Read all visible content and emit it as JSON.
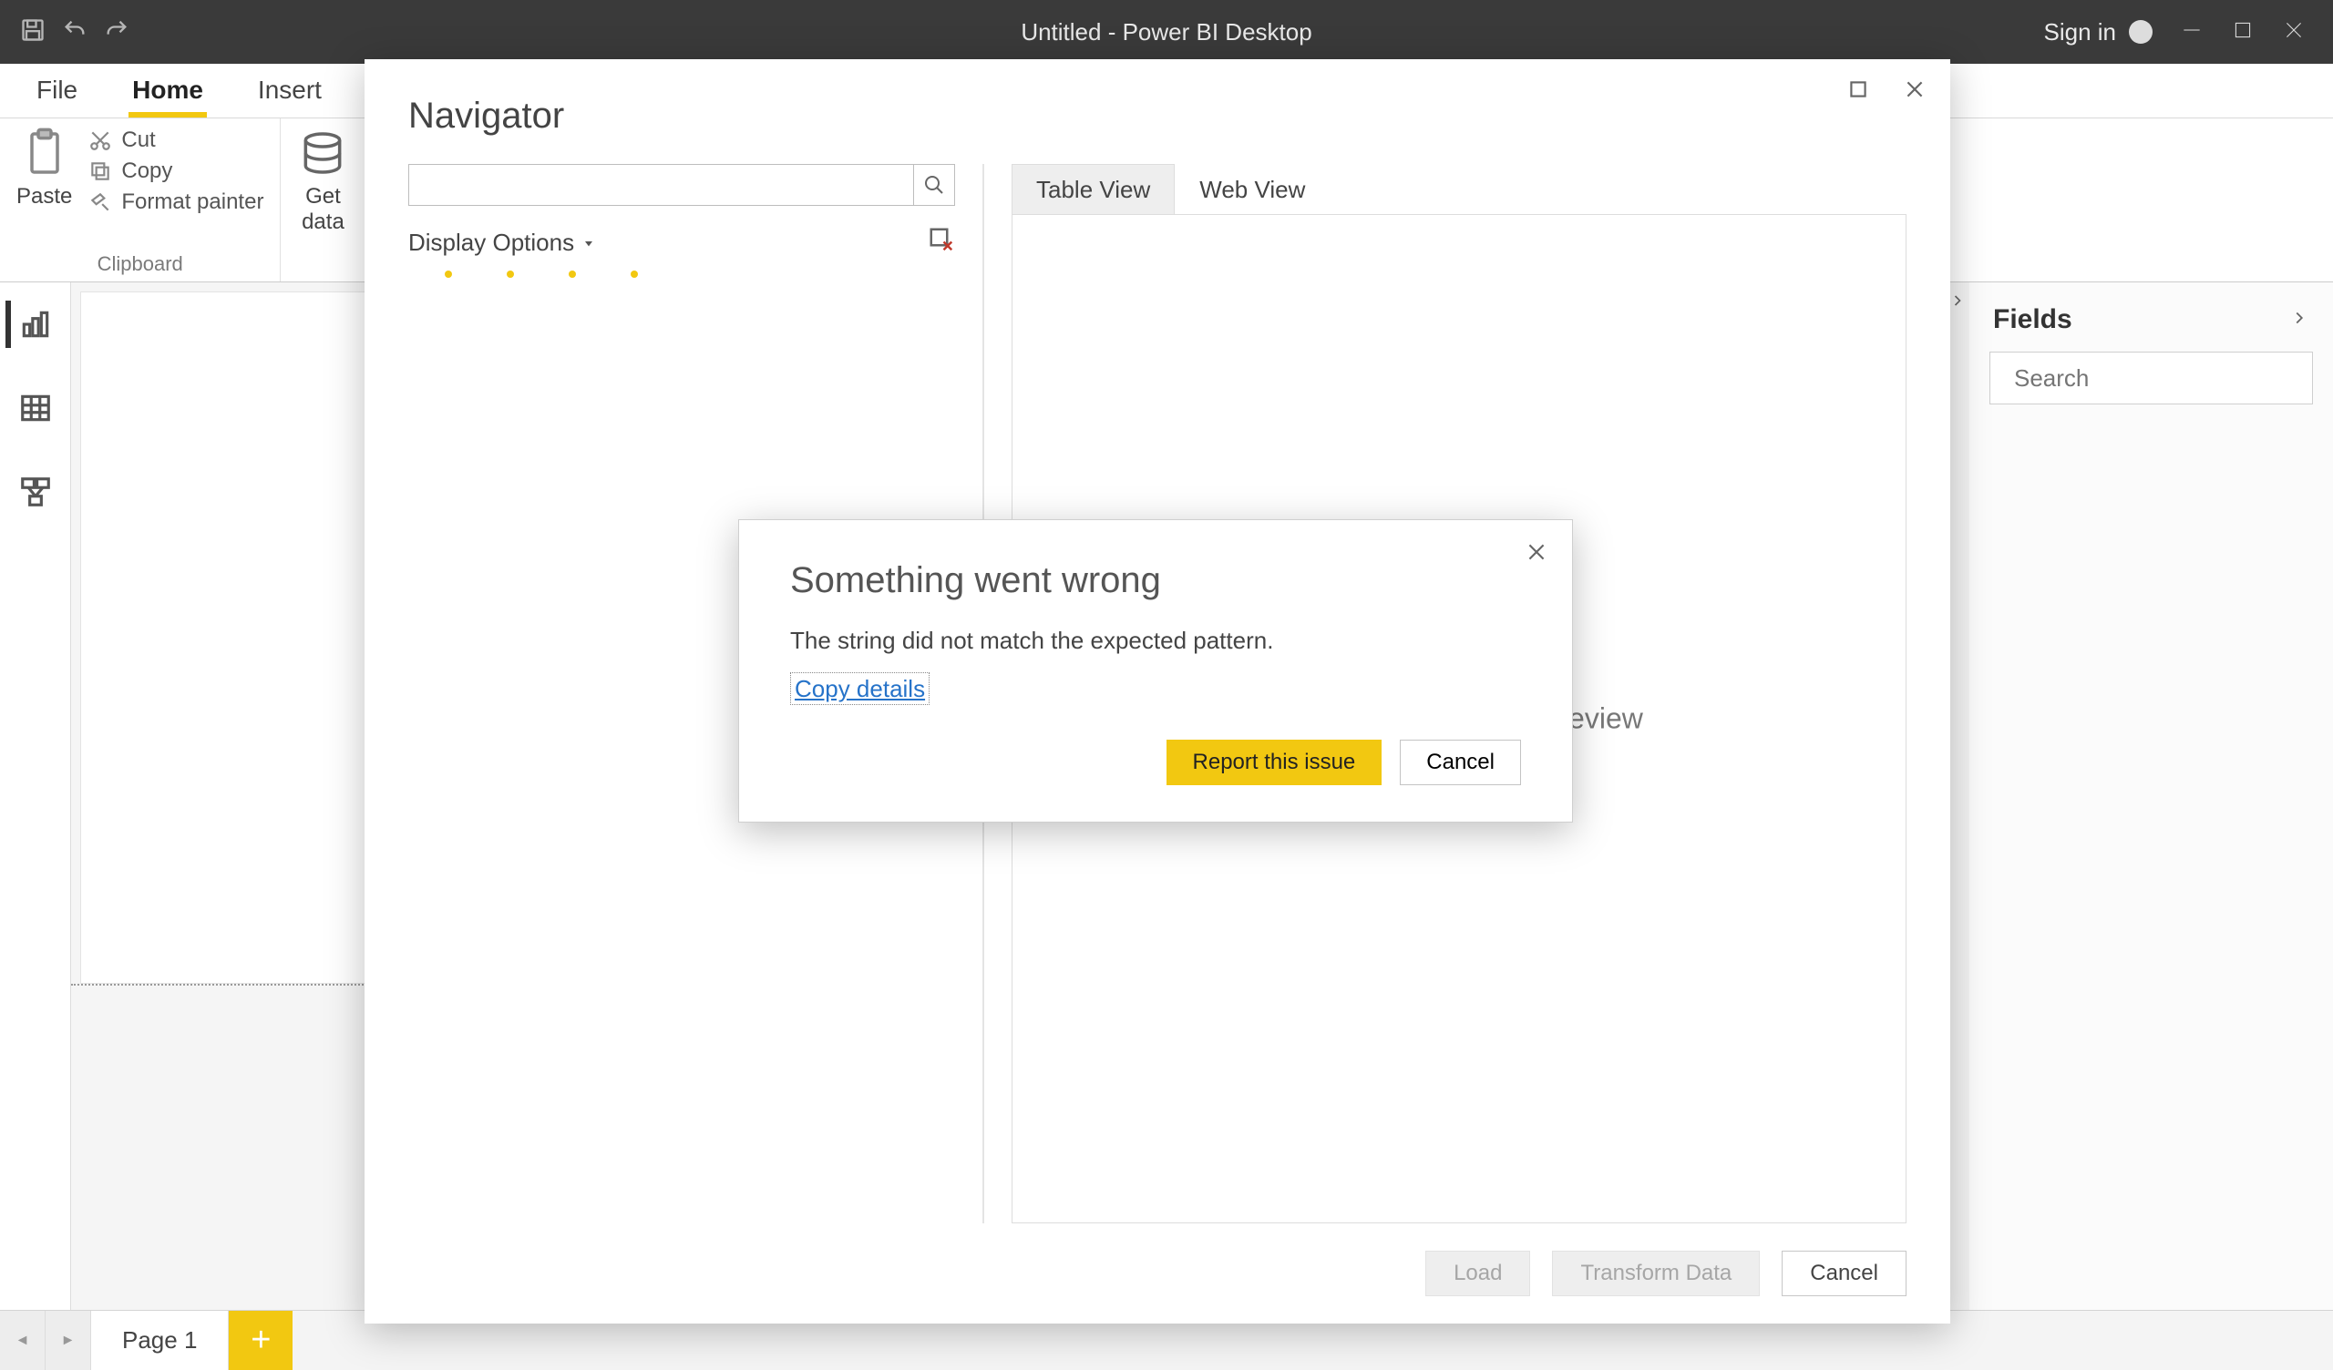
{
  "titlebar": {
    "title": "Untitled - Power BI Desktop",
    "signin": "Sign in"
  },
  "ribbonTabs": {
    "file": "File",
    "home": "Home",
    "insert": "Insert"
  },
  "ribbon": {
    "clipboard": {
      "paste": "Paste",
      "cut": "Cut",
      "copy": "Copy",
      "formatPainter": "Format painter",
      "groupLabel": "Clipboard"
    },
    "data": {
      "getData": "Get\ndata"
    }
  },
  "fields": {
    "title": "Fields",
    "searchPlaceholder": "Search"
  },
  "statusbar": {
    "page": "Page 1",
    "add": "+"
  },
  "navigator": {
    "title": "Navigator",
    "displayOptions": "Display Options",
    "tableView": "Table View",
    "webView": "Web View",
    "previewHint": "No item selected for preview",
    "load": "Load",
    "transform": "Transform Data",
    "cancel": "Cancel"
  },
  "errorDialog": {
    "title": "Something went wrong",
    "message": "The string did not match the expected pattern.",
    "copyDetails": "Copy details",
    "report": "Report this issue",
    "cancel": "Cancel"
  }
}
